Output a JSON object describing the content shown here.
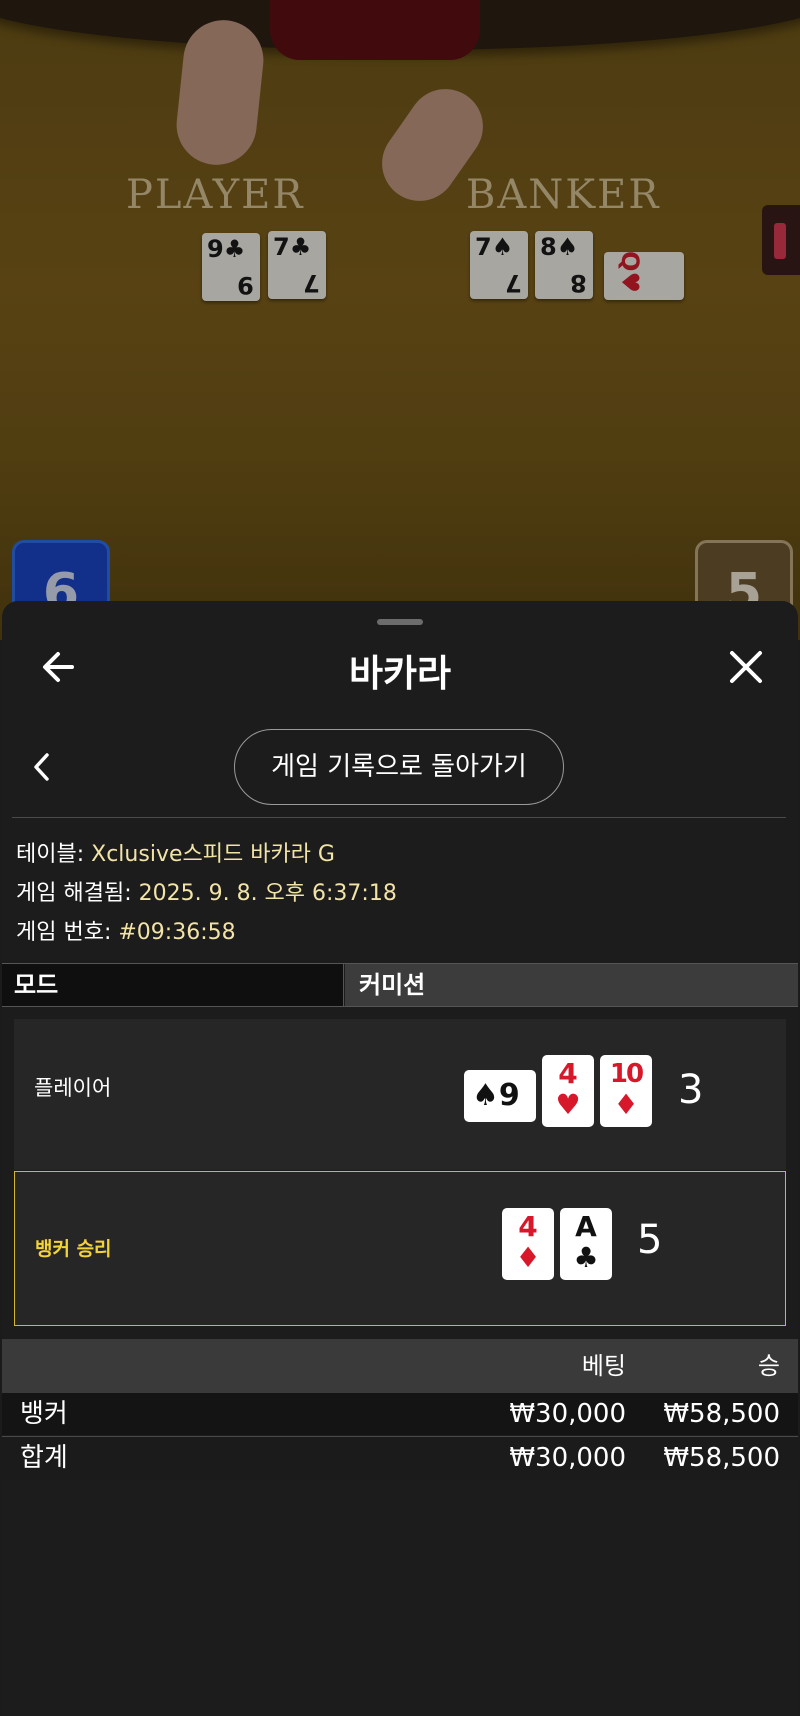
{
  "video": {
    "player_label": "PLAYER",
    "banker_label": "BANKER",
    "player_cards": [
      {
        "rank": "9",
        "suit": "♣",
        "color": "black"
      },
      {
        "rank": "7",
        "suit": "♣",
        "color": "black"
      }
    ],
    "banker_cards": [
      {
        "rank": "7",
        "suit": "♠",
        "color": "black"
      },
      {
        "rank": "8",
        "suit": "♠",
        "color": "black"
      },
      {
        "rank": "Q",
        "suit": "♥",
        "color": "red"
      }
    ],
    "player_score": "6",
    "banker_score": "5"
  },
  "header": {
    "title": "바카라",
    "back_icon": "arrow-left-icon",
    "close_icon": "close-icon"
  },
  "nav": {
    "back_to_history": "게임 기록으로 돌아가기"
  },
  "info": {
    "table_label": "테이블: ",
    "table_value": "Xclusive스피드 바카라 G",
    "resolved_label": "게임 해결됨: ",
    "resolved_value": "2025. 9. 8. 오후 6:37:18",
    "game_no_label": "게임 번호: ",
    "game_no_value": "#09:36:58"
  },
  "mode": {
    "label": "모드",
    "value": "커미션"
  },
  "hands": {
    "player": {
      "label": "플레이어",
      "score": "3",
      "cards": [
        {
          "rank": "9",
          "suit": "♠",
          "color": "black",
          "rotated": true
        },
        {
          "rank": "4",
          "suit": "♥",
          "color": "red"
        },
        {
          "rank": "10",
          "suit": "♦",
          "color": "red"
        }
      ]
    },
    "banker": {
      "label": "뱅커 승리",
      "score": "5",
      "cards": [
        {
          "rank": "4",
          "suit": "♦",
          "color": "red"
        },
        {
          "rank": "A",
          "suit": "♣",
          "color": "black"
        }
      ]
    }
  },
  "bets": {
    "col_bet": "베팅",
    "col_win": "승",
    "rows": [
      {
        "name": "뱅커",
        "bet": "₩30,000",
        "win": "₩58,500"
      },
      {
        "name": "합계",
        "bet": "₩30,000",
        "win": "₩58,500"
      }
    ]
  },
  "colors": {
    "accent_gold": "#d4b62d",
    "info_value": "#f2e3a7",
    "card_red": "#d7182a",
    "player_blue": "#1a43c0"
  }
}
